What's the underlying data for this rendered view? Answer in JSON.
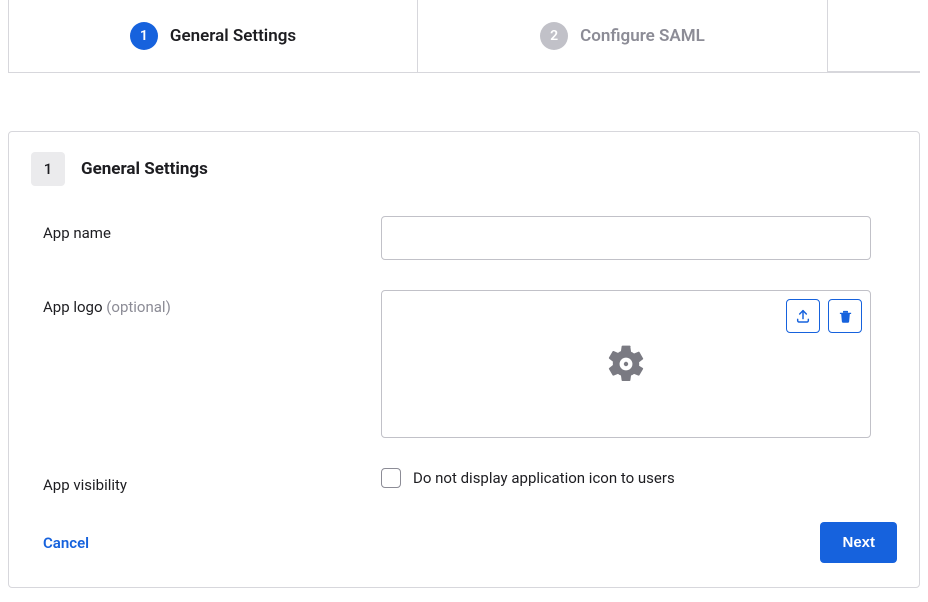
{
  "stepper": {
    "step1": {
      "number": "1",
      "label": "General Settings"
    },
    "step2": {
      "number": "2",
      "label": "Configure SAML"
    }
  },
  "panel": {
    "step_number": "1",
    "title": "General Settings"
  },
  "form": {
    "app_name_label": "App name",
    "app_name_value": "",
    "app_logo_label": "App logo ",
    "app_logo_optional": "(optional)",
    "app_visibility_label": "App visibility",
    "visibility_checkbox_label": "Do not display application icon to users"
  },
  "actions": {
    "cancel": "Cancel",
    "next": "Next"
  },
  "icons": {
    "upload": "upload-icon",
    "delete": "trash-icon",
    "gear": "gear-icon"
  }
}
